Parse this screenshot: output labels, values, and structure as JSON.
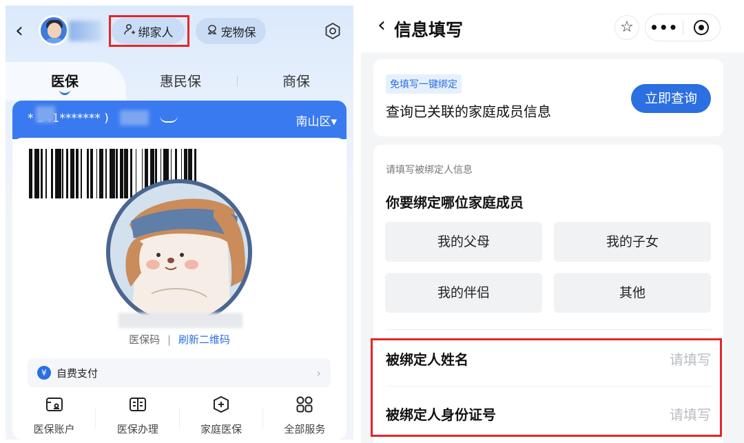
{
  "left_panel": {
    "header": {
      "bind_label": "绑家人",
      "pet_label": "宠物保"
    },
    "tabs": [
      {
        "label": "医保",
        "active": true
      },
      {
        "label": "惠民保",
        "active": false
      },
      {
        "label": "商保",
        "active": false
      }
    ],
    "card": {
      "id_masked": "*     341*******          )",
      "district": "南山区▾",
      "code_label": "医保码",
      "separator": "|",
      "refresh_label": "刷新二维码"
    },
    "payment": {
      "icon": "¥",
      "label": "自费支付"
    },
    "services": [
      {
        "icon": "wallet-icon",
        "label": "医保账户"
      },
      {
        "icon": "book-icon",
        "label": "医保办理"
      },
      {
        "icon": "medical-plus-icon",
        "label": "家庭医保"
      },
      {
        "icon": "grid-icon",
        "label": "全部服务"
      }
    ]
  },
  "right_panel": {
    "header": {
      "title": "信息填写"
    },
    "quick_bind": {
      "tag": "免填写一键绑定",
      "title": "查询已关联的家庭成员信息",
      "button": "立即查询"
    },
    "form": {
      "hint": "请填写被绑定人信息",
      "question": "你要绑定哪位家庭成员",
      "options": [
        "我的父母",
        "我的子女",
        "我的伴侣",
        "其他"
      ],
      "name_label": "被绑定人姓名",
      "name_placeholder": "请填写",
      "id_label": "被绑定人身份证号",
      "id_placeholder": "请填写"
    }
  },
  "colors": {
    "accent": "#2b6fe0",
    "card_blue": "#3a7af0",
    "highlight": "#e3252a"
  }
}
